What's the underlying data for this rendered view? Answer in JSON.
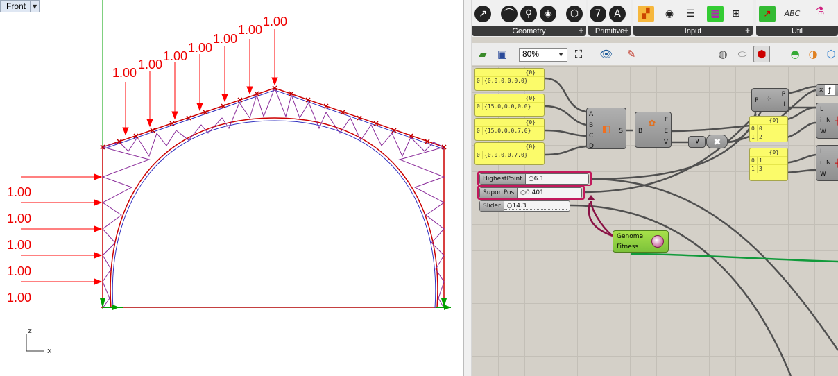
{
  "viewport": {
    "tab_label": "Front",
    "vertical_loads": [
      "1.00",
      "1.00",
      "1.00",
      "1.00",
      "1.00",
      "1.00",
      "1.00"
    ],
    "horizontal_loads": [
      "1.00",
      "1.00",
      "1.00",
      "1.00",
      "1.00"
    ],
    "axis_z": "z",
    "axis_x": "x",
    "colors": {
      "load": "#ff0000",
      "structure": "#cc0000",
      "secondary": "#3030c0",
      "support": "#00a000"
    }
  },
  "ribbon": {
    "groups": [
      "Geometry",
      "Primitive",
      "Input",
      "Util"
    ]
  },
  "toolbar": {
    "zoom": "80%"
  },
  "canvas": {
    "panels": [
      {
        "header": "{0}",
        "index": "0",
        "value": "{0.0,0.0,0.0}"
      },
      {
        "header": "{0}",
        "index": "0",
        "value": "{15.0,0.0,0.0}"
      },
      {
        "header": "{0}",
        "index": "0",
        "value": "{15.0,0.0,7.0}"
      },
      {
        "header": "{0}",
        "index": "0",
        "value": "{0.0,0.0,7.0}"
      },
      {
        "header": "{0}",
        "rows": [
          {
            "index": "0",
            "value": "0"
          },
          {
            "index": "1",
            "value": "2"
          }
        ]
      },
      {
        "header": "{0}",
        "rows": [
          {
            "index": "0",
            "value": "1"
          },
          {
            "index": "1",
            "value": "3"
          }
        ]
      }
    ],
    "surface_inputs": [
      "A",
      "B",
      "C",
      "D"
    ],
    "surface_output": "S",
    "brep_input": "B",
    "brep_outputs": [
      "F",
      "E",
      "V"
    ],
    "pt_component": {
      "input": "P",
      "outputs": [
        "P",
        "I"
      ]
    },
    "list_components": [
      {
        "inputs": [
          "L",
          "i",
          "W"
        ],
        "output": "N"
      },
      {
        "inputs": [
          "L",
          "i",
          "W"
        ],
        "output": "N"
      }
    ],
    "x_component_label": "x",
    "sliders": [
      {
        "name": "HighestPoint",
        "value": "6.1"
      },
      {
        "name": "SuportPos",
        "value": "0.401"
      },
      {
        "name": "Slider",
        "value": "14.3"
      }
    ],
    "genome": {
      "label_a": "Genome",
      "label_b": "Fitness"
    }
  }
}
